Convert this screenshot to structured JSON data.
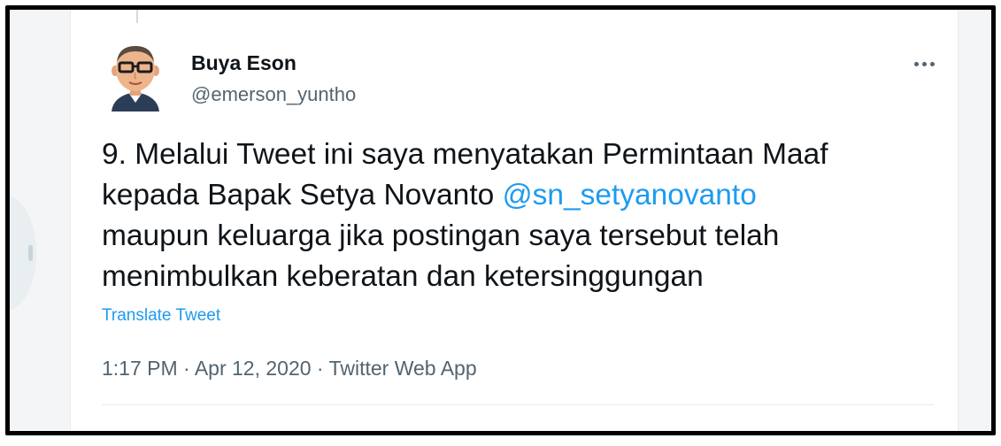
{
  "tweet": {
    "author": {
      "name": "Buya Eson",
      "handle": "@emerson_yuntho"
    },
    "text": {
      "line1": "9. Melalui Tweet ini saya menyatakan Permintaan Maaf",
      "line2_prefix": "kepada Bapak Setya Novanto ",
      "mention": "@sn_setyanovanto",
      "line3": "maupun keluarga jika postingan saya tersebut telah",
      "line4": "menimbulkan keberatan dan ketersinggungan"
    },
    "translate_label": "Translate Tweet",
    "meta": {
      "time": "1:17 PM",
      "separator": " · ",
      "date": "Apr 12, 2020",
      "source": "Twitter Web App"
    }
  },
  "icons": {
    "more": "more-horizontal-icon",
    "avatar": "avatar-illustration"
  },
  "colors": {
    "link": "#1d9bf0",
    "text": "#0f1419",
    "secondary": "#536471",
    "frame": "#000000"
  }
}
